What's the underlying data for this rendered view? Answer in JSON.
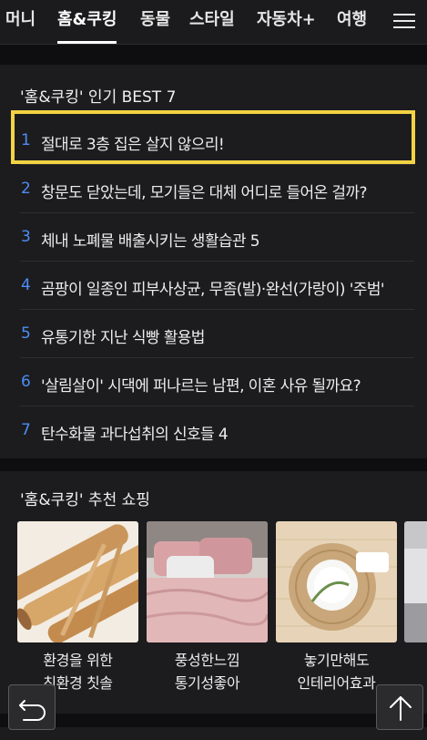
{
  "nav": {
    "tabs": [
      "머니",
      "홈&쿠킹",
      "동물",
      "스타일",
      "자동차+",
      "여행"
    ],
    "active_tab": "홈&쿠킹",
    "menu_icon": "hamburger-menu-icon"
  },
  "best": {
    "title": "'홈&쿠킹' 인기 BEST 7",
    "items": [
      {
        "rank": "1",
        "text": "절대로 3층 집은 살지 않으리!"
      },
      {
        "rank": "2",
        "text": "창문도 닫았는데, 모기들은 대체 어디로 들어온 걸까?"
      },
      {
        "rank": "3",
        "text": "체내 노폐물 배출시키는 생활습관 5"
      },
      {
        "rank": "4",
        "text": "곰팡이 일종인 피부사상균, 무좀(발)·완선(가랑이) '주범'"
      },
      {
        "rank": "5",
        "text": "유통기한 지난 식빵 활용법"
      },
      {
        "rank": "6",
        "text": "'살림살이' 시댁에 퍼나르는 남편, 이혼 사유 될까요?"
      },
      {
        "rank": "7",
        "text": "탄수화물 과다섭취의 신호들 4"
      }
    ],
    "rank_color": "#4d8df5",
    "highlight_color": "#f3d344"
  },
  "shopping": {
    "title": "'홈&쿠킹' 추천 쇼핑",
    "cards": [
      {
        "line1": "환경을 위한",
        "line2": "친환경 칫솔"
      },
      {
        "line1": "풍성한느낌",
        "line2": "통기성좋아"
      },
      {
        "line1": "놓기만해도",
        "line2": "인테리어효과"
      }
    ]
  },
  "floating": {
    "back_icon": "undo-arrow-icon",
    "top_icon": "arrow-up-icon"
  }
}
